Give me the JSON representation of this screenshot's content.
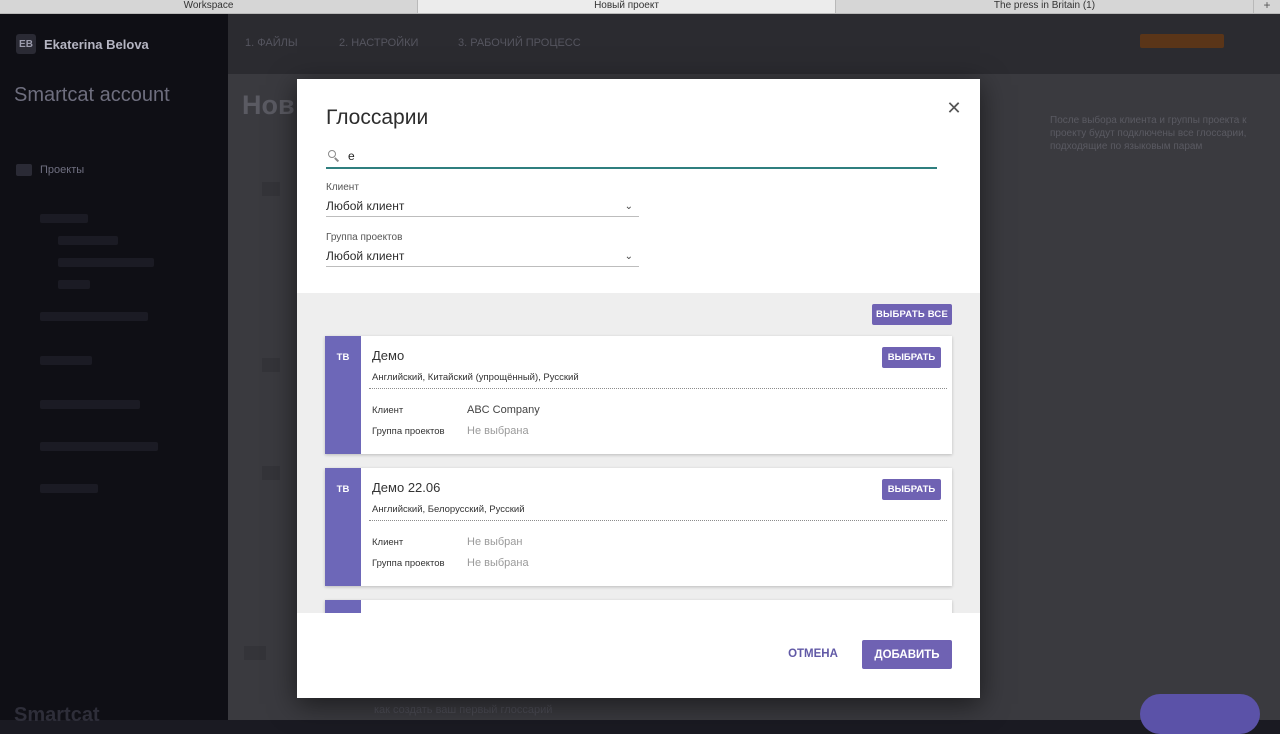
{
  "browser": {
    "tabs": [
      "Workspace",
      "Новый проект",
      "The press in Britain (1)"
    ],
    "active_tab": 1,
    "new_tab": "+"
  },
  "background": {
    "user_initials": "EB",
    "user_name": "Ekaterina Belova",
    "account_name": "Smartcat account",
    "sidebar_projects": "Проекты",
    "steps": [
      "1. ФАЙЛЫ",
      "2. НАСТРОЙКИ",
      "3. РАБОЧИЙ ПРОЦЕСС"
    ],
    "page_title": "Нов",
    "brand_bottom": "Smartcat",
    "right_note": "После выбора клиента и группы проекта к проекту будут подключены все глоссарии, подходящие по языковым парам",
    "bottom_help": "как создать ваш первый глоссарий"
  },
  "modal": {
    "title": "Глоссарии",
    "close_symbol": "✕",
    "search": {
      "value": "e",
      "placeholder": ""
    },
    "client_filter": {
      "label": "Клиент",
      "value": "Любой клиент"
    },
    "group_filter": {
      "label": "Группа проектов",
      "value": "Любой клиент"
    },
    "select_all_label": "ВЫБРАТЬ ВСЕ",
    "cards": [
      {
        "tag": "TB",
        "title": "Демо",
        "languages": "Английский, Китайский (упрощённый), Русский",
        "select_label": "ВЫБРАТЬ",
        "client_label": "Клиент",
        "client_value": "ABC Company",
        "group_label": "Группа проектов",
        "group_value": "Не выбрана"
      },
      {
        "tag": "TB",
        "title": "Демо 22.06",
        "languages": "Английский, Белорусский, Русский",
        "select_label": "ВЫБРАТЬ",
        "client_label": "Клиент",
        "client_value": "Не выбран",
        "group_label": "Группа проектов",
        "group_value": "Не выбрана"
      }
    ],
    "cancel_label": "ОТМЕНА",
    "add_label": "ДОБАВИТЬ"
  },
  "colors": {
    "accent": "#6f62b3",
    "tag": "#6d67b8",
    "search_underline": "#2f7f7f"
  },
  "icons": [
    "search-icon",
    "chevron-down-icon",
    "close-icon",
    "folder-icon",
    "pencil-icon"
  ]
}
